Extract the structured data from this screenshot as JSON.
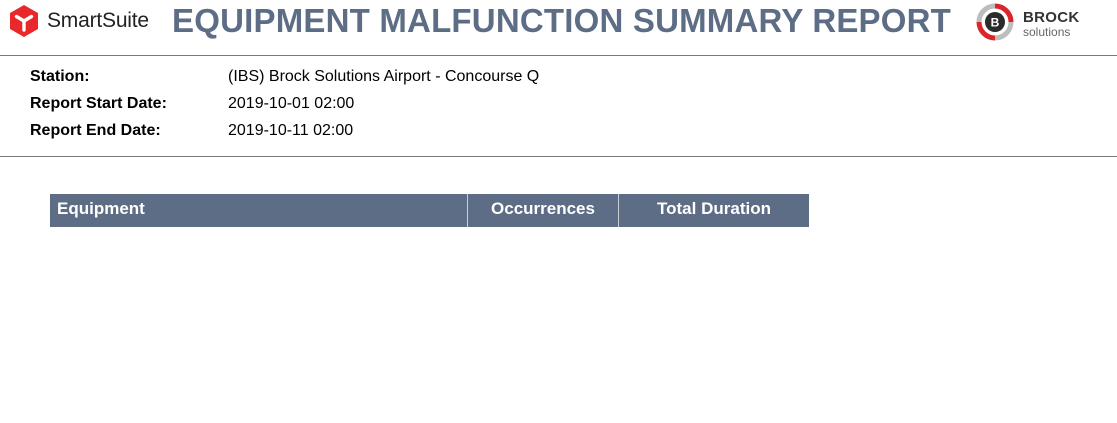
{
  "header": {
    "brand_name": "SmartSuite",
    "title": "EQUIPMENT MALFUNCTION SUMMARY REPORT",
    "partner_name": "BROCK",
    "partner_sub": "solutions",
    "partner_badge": "B"
  },
  "meta": {
    "station_label": "Station:",
    "station_value": "(IBS) Brock Solutions Airport - Concourse Q",
    "start_label": "Report Start Date:",
    "start_value": "2019-10-01 02:00",
    "end_label": "Report End Date:",
    "end_value": "2019-10-11 02:00"
  },
  "table": {
    "columns": [
      "Equipment",
      "Occurrences",
      "Total Duration"
    ],
    "rows": []
  },
  "colors": {
    "title": "#5d6d85",
    "table_header_bg": "#5d6d85",
    "smartsuite_red": "#e8282b",
    "brock_red": "#d9262a"
  },
  "icons": {
    "smartsuite_logo": "smartsuite-logo-icon",
    "brock_logo": "brock-logo-icon"
  }
}
